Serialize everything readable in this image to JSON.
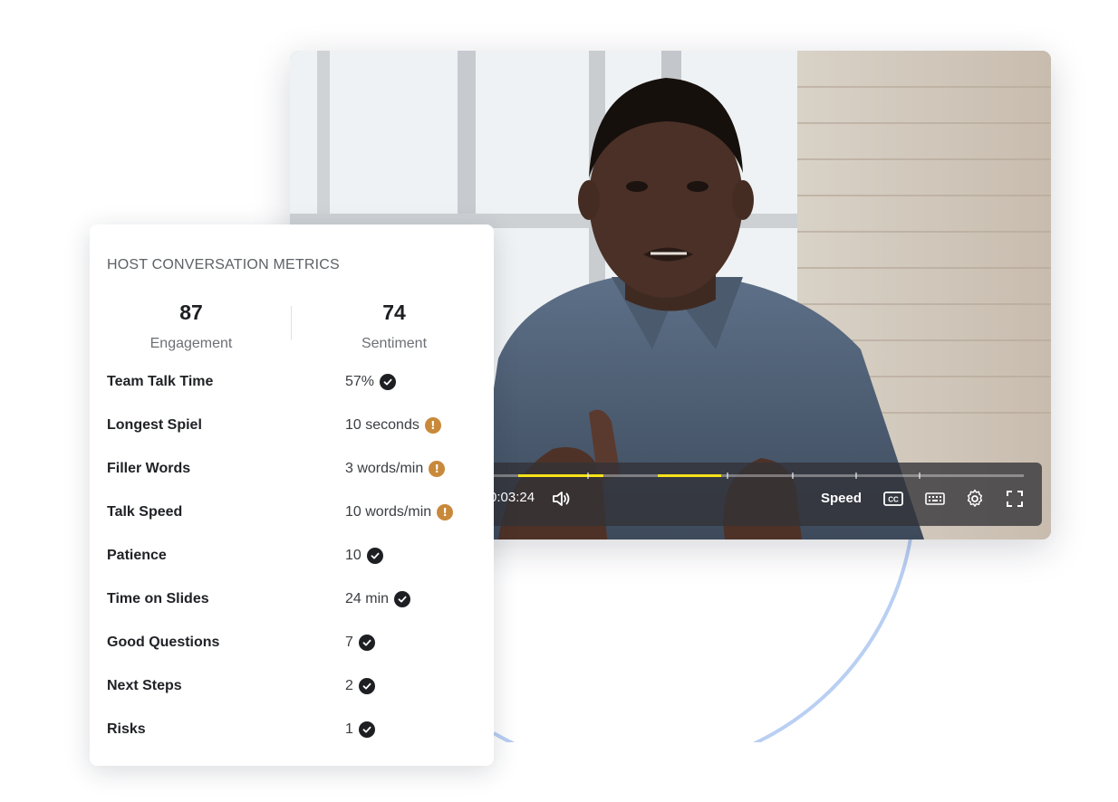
{
  "player": {
    "time": "0:03:24",
    "speed_label": "Speed",
    "icons": [
      "volume-icon",
      "closed-captions-icon",
      "keyboard-icon",
      "settings-icon",
      "fullscreen-icon"
    ]
  },
  "card": {
    "title": "HOST CONVERSATION METRICS",
    "scores": [
      {
        "value": "87",
        "label": "Engagement"
      },
      {
        "value": "74",
        "label": "Sentiment"
      }
    ],
    "metrics": [
      {
        "name": "Team Talk Time",
        "value": "57%",
        "status": "ok"
      },
      {
        "name": "Longest Spiel",
        "value": "10 seconds",
        "status": "warning"
      },
      {
        "name": "Filler Words",
        "value": "3 words/min",
        "status": "warning"
      },
      {
        "name": "Talk Speed",
        "value": "10 words/min",
        "status": "warning"
      },
      {
        "name": "Patience",
        "value": "10",
        "status": "ok"
      },
      {
        "name": "Time on Slides",
        "value": "24 min",
        "status": "ok"
      },
      {
        "name": "Good Questions",
        "value": "7",
        "status": "ok"
      },
      {
        "name": "Next Steps",
        "value": "2",
        "status": "ok"
      },
      {
        "name": "Risks",
        "value": "1",
        "status": "ok"
      }
    ]
  },
  "colors": {
    "ok_badge": "#1d1f23",
    "warning_badge": "#c9893a",
    "progress_highlight": "#f7e21a",
    "arc": "#b9cff3"
  }
}
